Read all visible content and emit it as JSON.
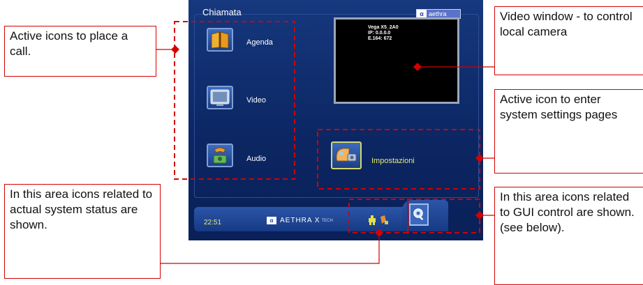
{
  "screen": {
    "title": "Chiamata",
    "brand_symbol": "α",
    "brand_text": "aethra",
    "menu": [
      {
        "label": "Agenda",
        "icon": "address-book-icon"
      },
      {
        "label": "Video",
        "icon": "video-monitor-icon"
      },
      {
        "label": "Audio",
        "icon": "telephone-icon"
      }
    ],
    "video_info": [
      "Vega X5_2A0",
      "IP: 0.0.0.0",
      "E.164: 672"
    ],
    "settings_label": "Impostazioni",
    "settings_icon": "settings-gear-icon",
    "clock": "22:51",
    "logo_symbol": "α",
    "logo_text": "AETHRA X",
    "logo_sub": "TECH",
    "status_icons": [
      "network-status-icon",
      "call-status-icon"
    ],
    "gui_control_icon": "zoom-control-icon"
  },
  "callouts": {
    "call_icons": "Active icons to place a call.",
    "video_window": "Video window - to control local camera",
    "settings": "Active icon to enter system settings pages",
    "status_area": "In this area icons related to actual system status are shown.",
    "gui_area": "In this area icons related to GUI control are shown. (see below)."
  },
  "colors": {
    "screen_bg": "#0d2a6b",
    "accent_red": "#d40000",
    "highlight_yellow": "#e7eb6e",
    "icon_border": "#7fa0d8"
  }
}
